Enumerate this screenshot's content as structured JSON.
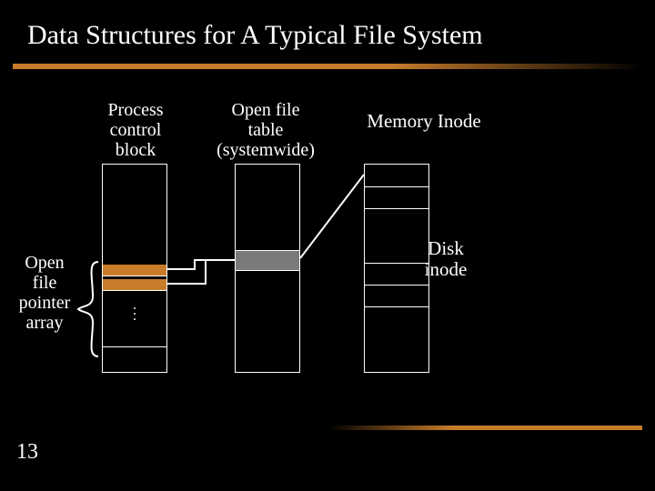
{
  "title": "Data Structures for A Typical File System",
  "page_number": "13",
  "labels": {
    "pcb": "Process\ncontrol\nblock",
    "oft": "Open file\ntable\n(systemwide)",
    "memory_inode": "Memory Inode",
    "disk_inode": "Disk\ninode",
    "open_file_pointer_array": "Open\nfile\npointer\narray"
  },
  "columns": {
    "pcb": {
      "label_key": "pcb"
    },
    "oft": {
      "label_key": "oft"
    },
    "mi": {
      "label_key": "memory_inode"
    }
  },
  "diagram": {
    "pcb_pointer_rows": 2,
    "oft_highlight_row_index": 4,
    "mi_visible_cell_dividers": [
      24,
      48,
      108,
      132,
      156
    ],
    "arrows": [
      {
        "name": "pcb-row0-to-oft",
        "from": "pcb.row0.right",
        "to": "oft.highlight.left"
      },
      {
        "name": "pcb-row1-to-oft",
        "from": "pcb.row1.right",
        "to": "oft.highlight.left"
      },
      {
        "name": "oft-to-mi",
        "from": "oft.highlight.right",
        "to": "mi.top_cell"
      }
    ]
  }
}
